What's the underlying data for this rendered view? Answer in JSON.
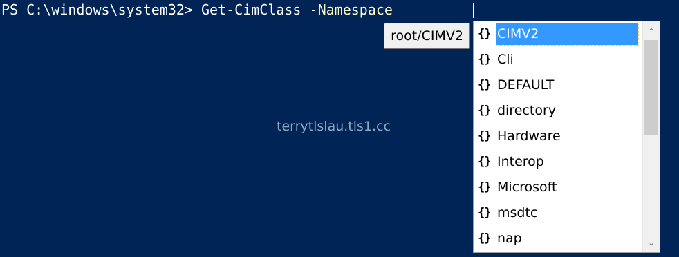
{
  "console": {
    "prompt": "PS C:\\windows\\system32> ",
    "command": "Get-CimClass",
    "parameter": " -Namespace "
  },
  "tooltip": {
    "text": "root/CIMV2"
  },
  "completion": {
    "items": [
      {
        "glyph": "{}",
        "label": "CIMV2",
        "selected": true
      },
      {
        "glyph": "{}",
        "label": "Cli"
      },
      {
        "glyph": "{}",
        "label": "DEFAULT"
      },
      {
        "glyph": "{}",
        "label": "directory"
      },
      {
        "glyph": "{}",
        "label": "Hardware"
      },
      {
        "glyph": "{}",
        "label": "Interop"
      },
      {
        "glyph": "{}",
        "label": "Microsoft"
      },
      {
        "glyph": "{}",
        "label": "msdtc"
      },
      {
        "glyph": "{}",
        "label": "nap"
      }
    ],
    "scroll_up": "⌃",
    "scroll_down": "⌄"
  },
  "watermark": "terrytlslau.tls1.cc",
  "colors": {
    "background": "#012456",
    "selection": "#3399ff",
    "parameter": "#ffffcc"
  }
}
